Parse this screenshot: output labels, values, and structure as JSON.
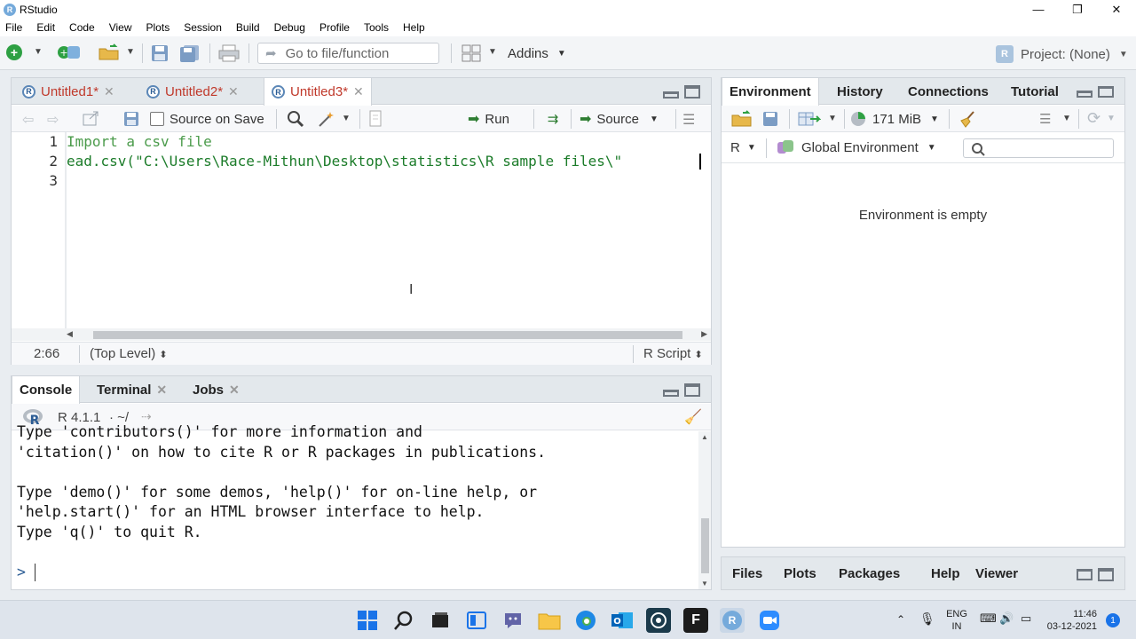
{
  "window": {
    "title": "RStudio",
    "minimize": "—",
    "restore": "❐",
    "close": "✕"
  },
  "menu": [
    "File",
    "Edit",
    "Code",
    "View",
    "Plots",
    "Session",
    "Build",
    "Debug",
    "Profile",
    "Tools",
    "Help"
  ],
  "toolbar": {
    "goto_placeholder": "Go to file/function",
    "addins_label": "Addins",
    "project_label": "Project: (None)"
  },
  "editor": {
    "tabs": [
      "Untitled1*",
      "Untitled2*",
      "Untitled3*"
    ],
    "active_tab": 2,
    "source_on_save": "Source on Save",
    "run_label": "Run",
    "source_label": "Source",
    "lines": [
      {
        "num": "1",
        "text": "Import a csv file"
      },
      {
        "num": "2",
        "text": "ead.csv(\"C:\\Users\\Race-Mithun\\Desktop\\statistics\\R sample files\\\""
      },
      {
        "num": "3",
        "text": ""
      }
    ],
    "status": {
      "position": "2:66",
      "scope": "(Top Level)",
      "filetype": "R Script"
    }
  },
  "console": {
    "tabs": [
      "Console",
      "Terminal",
      "Jobs"
    ],
    "version": "R 4.1.1",
    "path": "· ~/",
    "lines": [
      "Type 'contributors()' for more information and",
      "'citation()' on how to cite R or R packages in publications.",
      "",
      "Type 'demo()' for some demos, 'help()' for on-line help, or",
      "'help.start()' for an HTML browser interface to help.",
      "Type 'q()' to quit R.",
      "",
      "> "
    ]
  },
  "environment": {
    "tabs": [
      "Environment",
      "History",
      "Connections",
      "Tutorial"
    ],
    "memory": "171 MiB",
    "language": "R",
    "scope": "Global Environment",
    "empty_message": "Environment is empty"
  },
  "files": {
    "tabs": [
      "Files",
      "Plots",
      "Packages",
      "Help",
      "Viewer"
    ]
  },
  "taskbar": {
    "lang": "ENG",
    "region": "IN",
    "time": "11:46",
    "date": "03-12-2021",
    "notifications": "1"
  },
  "colors": {
    "accent": "#75aadb",
    "comment": "#4b9b4b",
    "string": "#1c7c2a",
    "tab_unsaved": "#c0392b"
  }
}
